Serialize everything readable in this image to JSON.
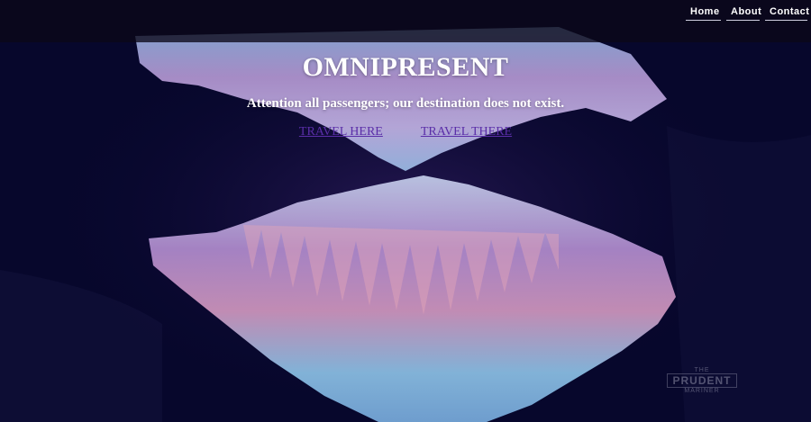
{
  "nav": {
    "items": [
      {
        "label": "Home"
      },
      {
        "label": "About"
      },
      {
        "label": "Contact"
      }
    ]
  },
  "hero": {
    "title": "OMNIPRESENT",
    "subtitle": "Attention all passengers; our destination does not exist.",
    "links": [
      {
        "label": "TRAVEL HERE"
      },
      {
        "label": "TRAVEL THERE"
      }
    ]
  },
  "watermark": {
    "top": "THE",
    "main": "PRUDENT",
    "bottom": "MARINER"
  },
  "colors": {
    "background": "#06062a",
    "link": "#5a2ea8",
    "text": "#ffffff"
  }
}
